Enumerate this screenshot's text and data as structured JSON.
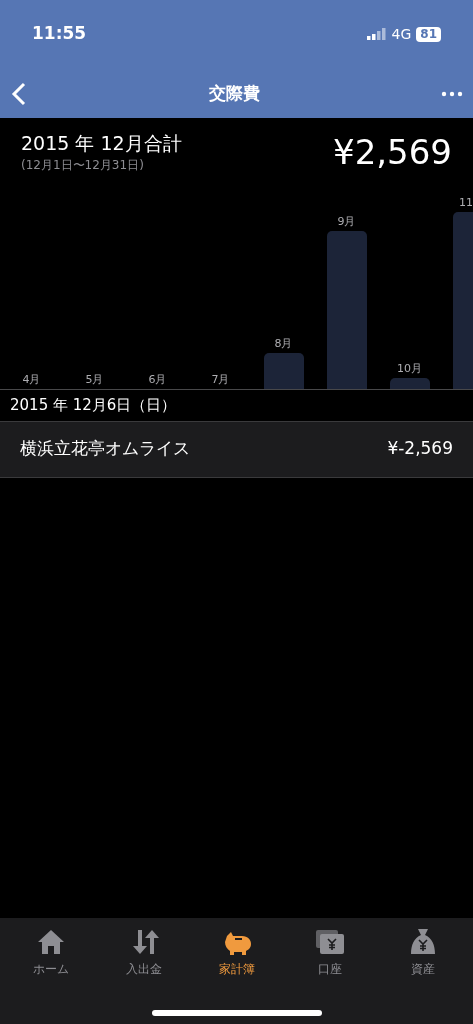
{
  "status_bar": {
    "time": "11:55",
    "network": "4G",
    "battery": "81"
  },
  "nav": {
    "title": "交際費"
  },
  "summary": {
    "title": "2015 年 12月合計",
    "range": "(12月1日〜12月31日)",
    "total": "¥2,569"
  },
  "months": [
    {
      "label": "4月"
    },
    {
      "label": "5月"
    },
    {
      "label": "6月"
    },
    {
      "label": "7月"
    },
    {
      "label": "8月"
    },
    {
      "label": "9月"
    },
    {
      "label": "10月"
    },
    {
      "label": "11"
    }
  ],
  "sections": [
    {
      "date": "2015 年 12月6日（日）",
      "entries": [
        {
          "name": "横浜立花亭オムライス",
          "amount": "¥-2,569"
        }
      ]
    }
  ],
  "tabs": [
    {
      "kind": "home",
      "label": "ホーム",
      "selected": false
    },
    {
      "kind": "transfer",
      "label": "入出金",
      "selected": false
    },
    {
      "kind": "budget",
      "label": "家計簿",
      "selected": true
    },
    {
      "kind": "account",
      "label": "口座",
      "selected": false
    },
    {
      "kind": "assets",
      "label": "資産",
      "selected": false
    }
  ]
}
